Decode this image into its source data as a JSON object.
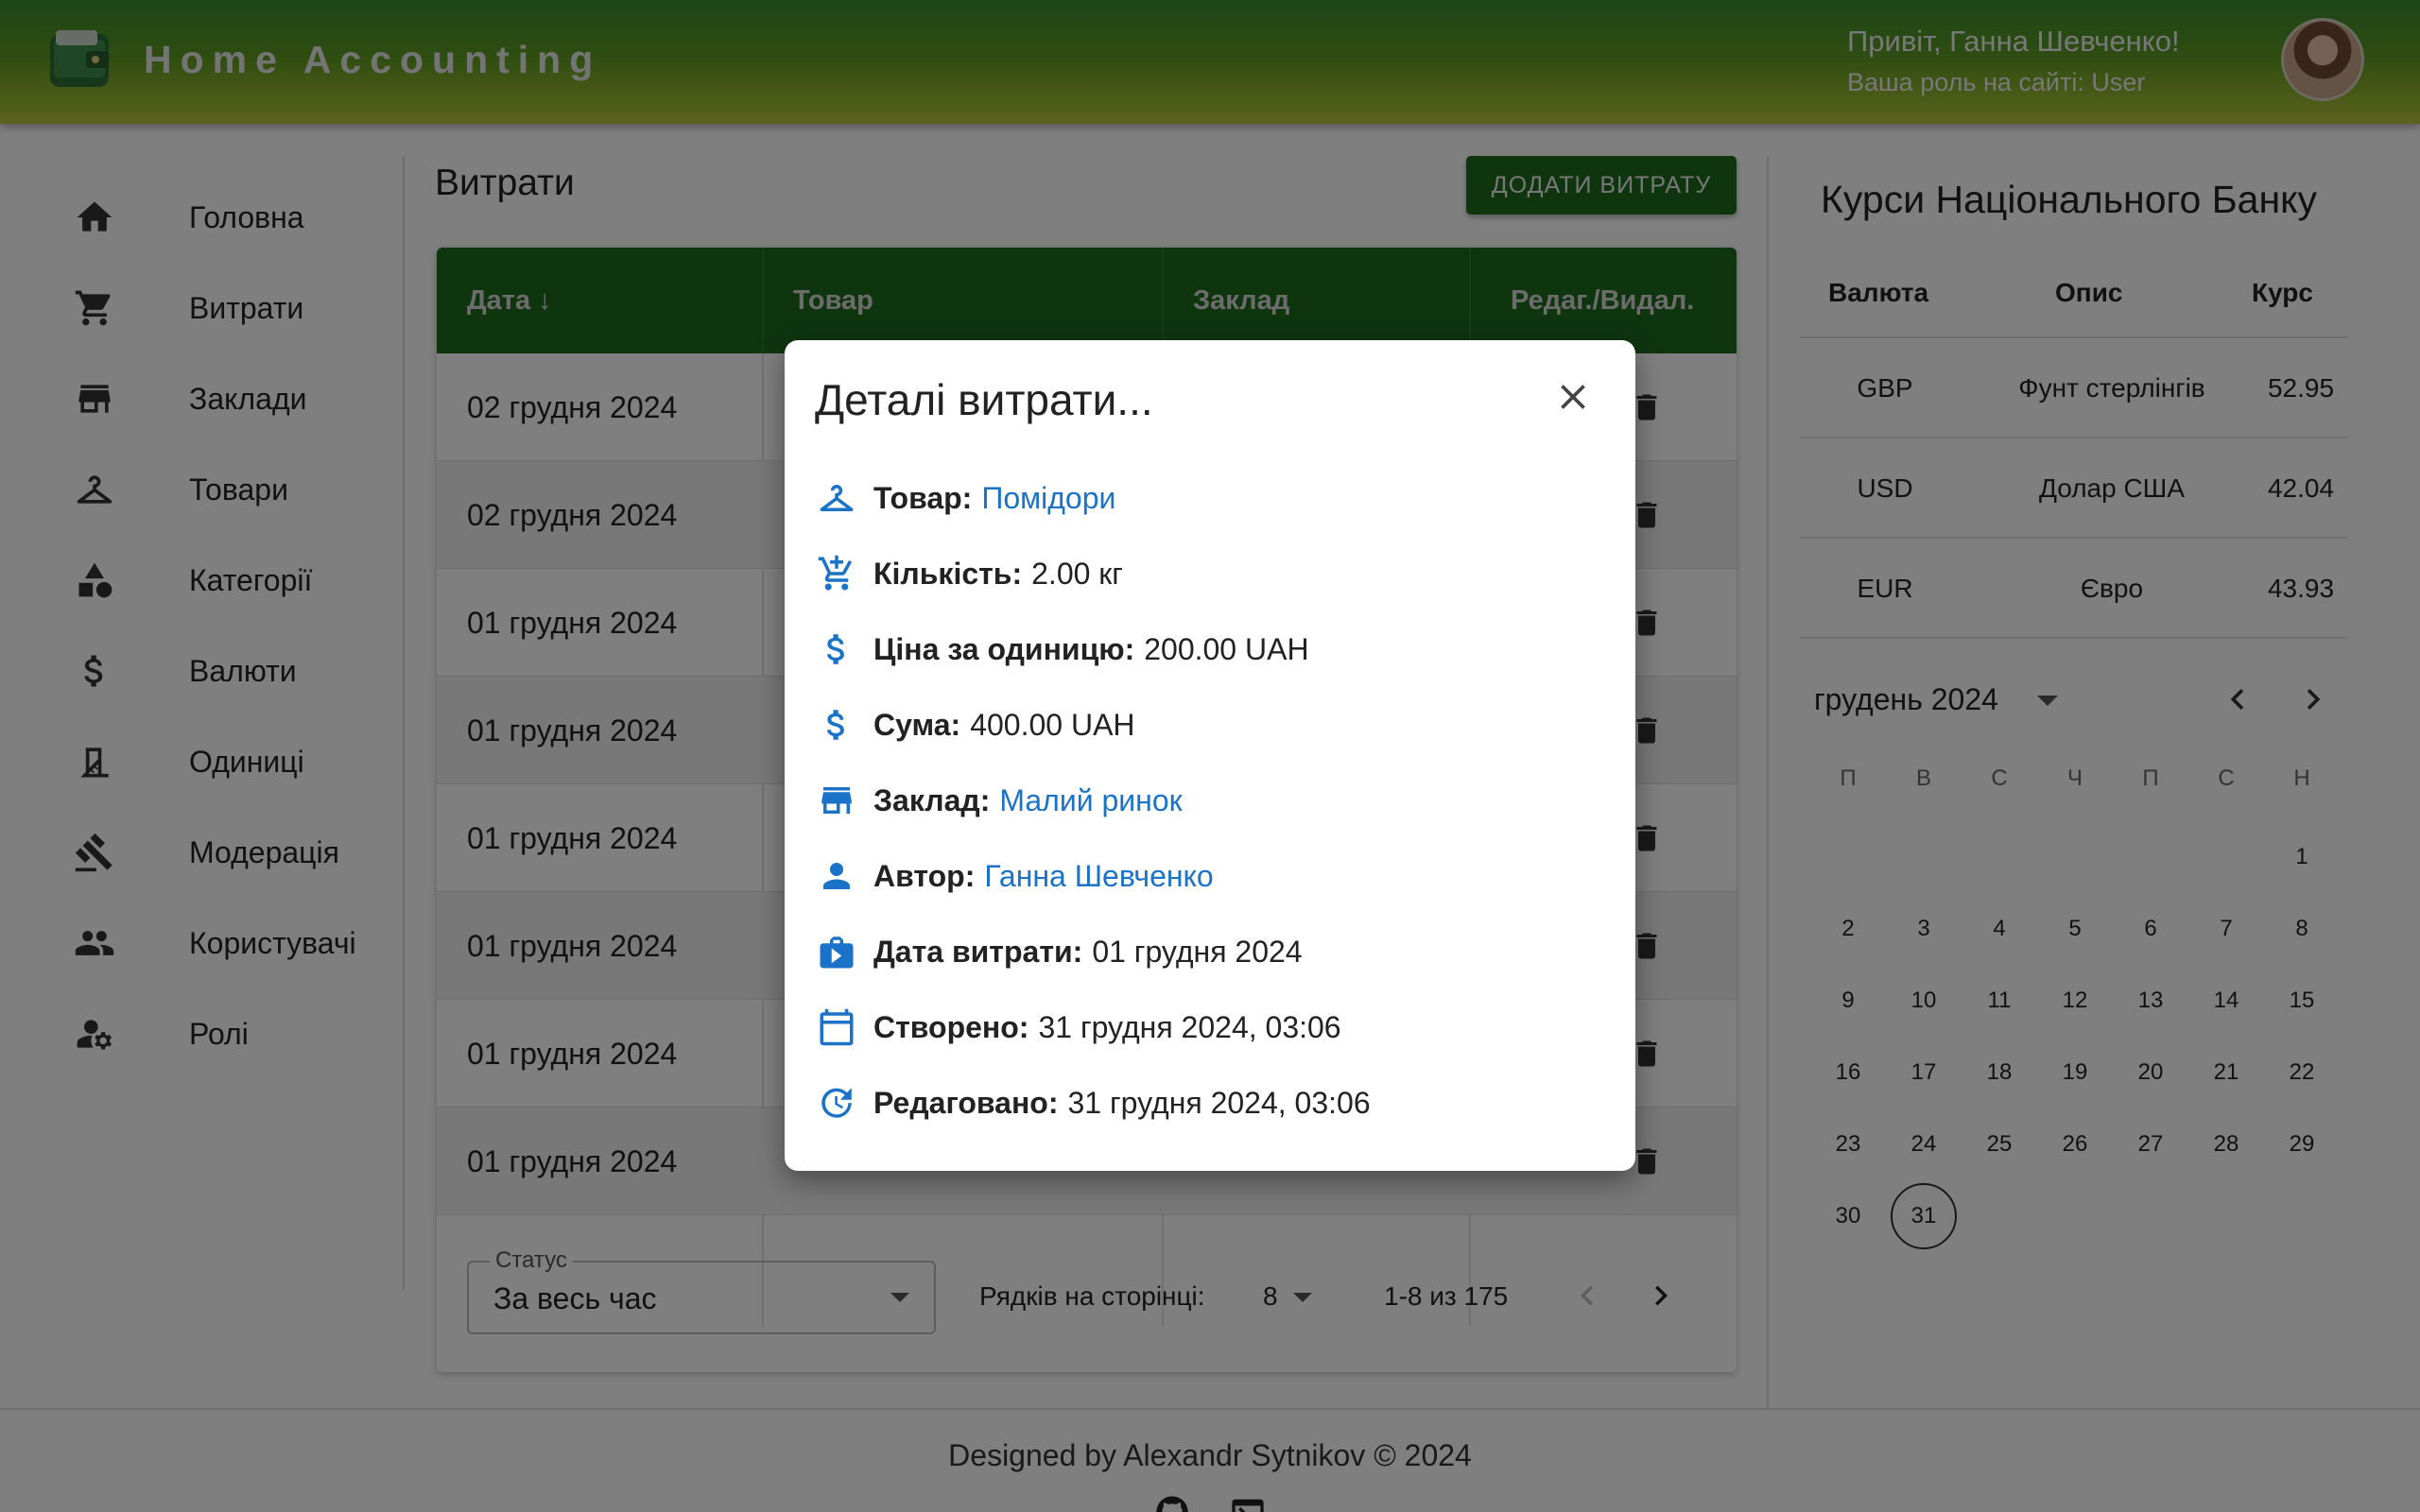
{
  "header": {
    "app_title": "Home Accounting",
    "greeting": "Привіт, Ганна Шевченко!",
    "role_line": "Ваша роль на сайті: User"
  },
  "sidebar": {
    "items": [
      {
        "label": "Головна",
        "icon": "home-icon"
      },
      {
        "label": "Витрати",
        "icon": "cart-icon"
      },
      {
        "label": "Заклади",
        "icon": "store-icon"
      },
      {
        "label": "Товари",
        "icon": "hanger-icon"
      },
      {
        "label": "Категорії",
        "icon": "shapes-icon"
      },
      {
        "label": "Валюти",
        "icon": "dollar-icon"
      },
      {
        "label": "Одиниці",
        "icon": "ruler-angle-icon"
      },
      {
        "label": "Модерація",
        "icon": "gavel-icon"
      },
      {
        "label": "Користувачі",
        "icon": "people-icon"
      },
      {
        "label": "Ролі",
        "icon": "user-settings-icon"
      }
    ]
  },
  "main": {
    "title": "Витрати",
    "add_button": "ДОДАТИ ВИТРАТУ",
    "columns": [
      "Дата ↓",
      "Товар",
      "Заклад",
      "Редаг./Видал."
    ],
    "rows": [
      {
        "date": "02 грудня 2024"
      },
      {
        "date": "02 грудня 2024"
      },
      {
        "date": "01 грудня 2024"
      },
      {
        "date": "01 грудня 2024"
      },
      {
        "date": "01 грудня 2024"
      },
      {
        "date": "01 грудня 2024"
      },
      {
        "date": "01 грудня 2024"
      },
      {
        "date": "01 грудня 2024"
      }
    ],
    "status_label": "Статус",
    "status_value": "За весь час",
    "rows_per_page_label": "Рядків на сторінці:",
    "rows_per_page_value": "8",
    "range": "1-8 из 175"
  },
  "rates": {
    "title": "Курси Національного Банку",
    "columns": [
      "Валюта",
      "Опис",
      "Курс"
    ],
    "rows": [
      {
        "code": "GBP",
        "desc": "Фунт стерлінгів",
        "rate": "52.95"
      },
      {
        "code": "USD",
        "desc": "Долар США",
        "rate": "42.04"
      },
      {
        "code": "EUR",
        "desc": "Євро",
        "rate": "43.93"
      }
    ]
  },
  "calendar": {
    "month": "грудень 2024",
    "weekdays": [
      "П",
      "В",
      "С",
      "Ч",
      "П",
      "С",
      "Н"
    ],
    "first_weekday_index": 6,
    "days_in_month": 31,
    "selected_day": 31
  },
  "footer": {
    "text": "Designed by Alexandr Sytnikov © 2024"
  },
  "modal": {
    "title": "Деталі витрати...",
    "details": [
      {
        "icon": "hanger-icon",
        "label": "Товар:",
        "value": "Помідори",
        "link": true
      },
      {
        "icon": "cart-arrow-icon",
        "label": "Кількість:",
        "value": "2.00 кг",
        "link": false
      },
      {
        "icon": "dollar-icon",
        "label": "Ціна за одиницю:",
        "value": "200.00 UAH",
        "link": false
      },
      {
        "icon": "dollar-icon",
        "label": "Сума:",
        "value": "400.00 UAH",
        "link": false
      },
      {
        "icon": "store-icon",
        "label": "Заклад:",
        "value": "Малий ринок",
        "link": true
      },
      {
        "icon": "person-icon",
        "label": "Автор:",
        "value": "Ганна Шевченко",
        "link": true
      },
      {
        "icon": "work-calendar-icon",
        "label": "Дата витрати:",
        "value": "01 грудня 2024",
        "link": false
      },
      {
        "icon": "calendar-icon",
        "label": "Створено:",
        "value": "31 грудня 2024, 03:06",
        "link": false
      },
      {
        "icon": "update-icon",
        "label": "Редаговано:",
        "value": "31 грудня 2024, 03:06",
        "link": false
      }
    ]
  },
  "colors": {
    "header_top": "#3b8a32",
    "header_bottom": "#b9c43a",
    "table_header": "#1e6b1e",
    "accent_link": "#1a73c8"
  }
}
